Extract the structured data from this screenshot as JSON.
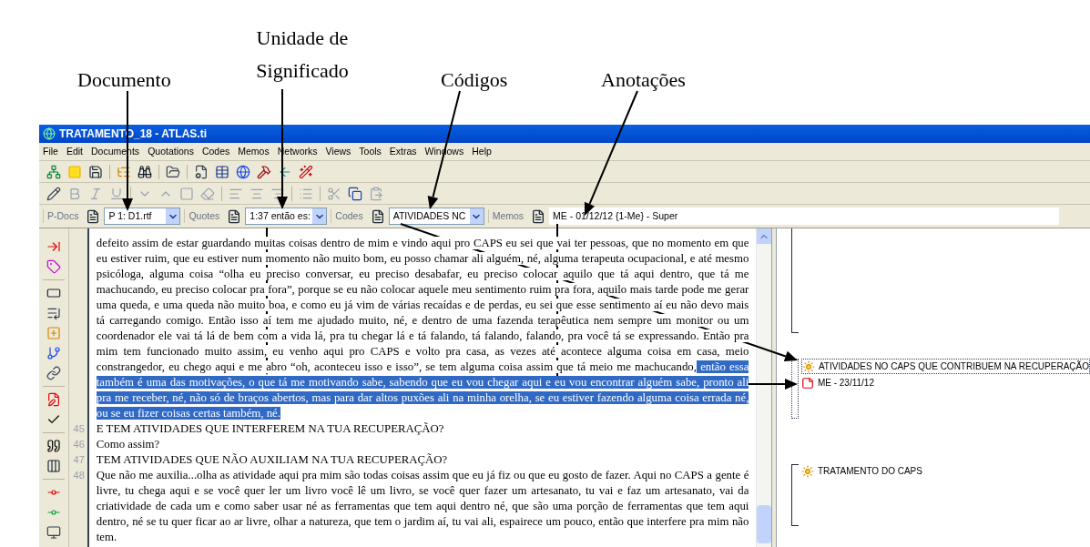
{
  "callouts": [
    {
      "text": "Documento"
    },
    {
      "text": "Unidade de Significado"
    },
    {
      "text": "Códigos"
    },
    {
      "text": "Anotações"
    }
  ],
  "window": {
    "title": "TRATAMENTO_18 - ATLAS.ti"
  },
  "menu": [
    "File",
    "Edit",
    "Documents",
    "Quotations",
    "Codes",
    "Memos",
    "Networks",
    "Views",
    "Tools",
    "Extras",
    "Windows",
    "Help"
  ],
  "selectors": [
    {
      "label": "P-Docs",
      "value": "P 1: D1.rtf",
      "kind": "combo"
    },
    {
      "label": "Quotes",
      "value": "1:37 então es:",
      "kind": "combo"
    },
    {
      "label": "Codes",
      "value": "ATIVIDADES NC",
      "kind": "combo"
    },
    {
      "label": "Memos",
      "value": "ME - 01/12/12 {1-Me} - Super",
      "kind": "field"
    }
  ],
  "document": {
    "blocks": [
      {
        "lines": [
          [
            {
              "text": "defeito assim de estar guardando muitas coisas dentro de mim e vindo aqui pro CAPS  eu sei que vai ter pessoas, que no momento em que",
              "selected": false
            }
          ],
          [
            {
              "text": "eu estiver ruim, que eu estiver num momento não muito bom, eu posso chamar ali alguém, né, alguma terapeuta ocupacional, e até mesmo",
              "selected": false
            }
          ],
          [
            {
              "text": "psicóloga, alguma coisa “olha eu preciso conversar, eu preciso desabafar, eu preciso colocar aquilo que tá aqui dentro, que tá me",
              "selected": false
            }
          ],
          [
            {
              "text": "machucando, eu preciso colocar pra fora”, porque se eu não colocar aquele meu sentimento ruim pra fora, aquilo mais tarde pode me gerar",
              "selected": false
            }
          ],
          [
            {
              "text": "uma queda, e uma queda não muito boa, e como eu já vim de várias recaídas e de perdas, eu sei que esse sentimento aí eu não devo mais",
              "selected": false
            }
          ],
          [
            {
              "text": "tá carregando comigo. Então isso aí tem me ajudado muito, né, e dentro de uma fazenda terapêutica nem sempre um monitor ou um",
              "selected": false
            }
          ],
          [
            {
              "text": "coordenador ele vai tá lá de bem com a vida lá, pra tu chegar lá e tá falando, tá falando, falando, pra você tá se expressando. Então pra",
              "selected": false
            }
          ],
          [
            {
              "text": "mim tem funcionado muito assim, eu venho aqui pro CAPS e volto pra casa, as vezes até acontece alguma coisa em casa, meio",
              "selected": false
            }
          ],
          [
            {
              "text": "constrangedor, eu chego aqui e me abro “oh, aconteceu isso e isso”, se tem alguma coisa assim que tá meio me machucando,",
              "selected": false
            },
            {
              "text": "então essa",
              "selected": true
            }
          ],
          [
            {
              "text": "também é uma das motivações, o que tá me motivando sabe, sabendo que eu vou chegar aqui e eu vou encontrar alguém sabe, pronto ali",
              "selected": true
            }
          ],
          [
            {
              "text": "pra me receber, né, não só de braços abertos, mas para dar altos puxões ali na minha orelha, se eu estiver fazendo alguma coisa errada né,",
              "selected": true
            }
          ],
          [
            {
              "text": "ou se eu fizer coisas certas também, né.",
              "selected": true
            }
          ]
        ]
      },
      {
        "number": "45",
        "lines": [
          [
            {
              "text": "E TEM ATIVIDADES QUE INTERFEREM NA TUA RECUPERAÇÃO?",
              "selected": false
            }
          ]
        ]
      },
      {
        "number": "46",
        "lines": [
          [
            {
              "text": "Como assim?",
              "selected": false
            }
          ]
        ]
      },
      {
        "number": "47",
        "lines": [
          [
            {
              "text": "TEM ATIVIDADES QUE NÃO AUXILIAM NA TUA RECUPERAÇÃO?",
              "selected": false
            }
          ]
        ]
      },
      {
        "number": "48",
        "lines": [
          [
            {
              "text": "Que não me auxilia...olha as atividade aqui pra mim são todas coisas assim que eu já fiz ou que eu gosto de fazer. Aqui no CAPS a gente é",
              "selected": false
            }
          ],
          [
            {
              "text": "livre, tu chega aqui e se você quer ler um livro você lê um livro, se você quer fazer um artesanato, tu vai e faz um artesanato, vai da",
              "selected": false
            }
          ],
          [
            {
              "text": "criatividade de cada um e como saber usar né as ferramentas que tem aqui dentro né, que são uma porção de ferramentas que tem aqui",
              "selected": false
            }
          ],
          [
            {
              "text": "dentro, né se tu quer ficar ao ar livre, olhar a natureza, que tem o jardim aí, tu vai ali, espairece um pouco, então que interfere pra mim não",
              "selected": false
            }
          ],
          [
            {
              "text": "tem.",
              "selected": false
            }
          ]
        ]
      }
    ]
  },
  "margin": {
    "groups": [
      {
        "selected": false
      },
      {
        "selected": true,
        "items": [
          {
            "kind": "code",
            "label": "ATIVIDADES NO CAPS QUE CONTRIBUEM NA RECUPERAÇÃO"
          },
          {
            "kind": "memo",
            "label": "ME - 23/11/12"
          }
        ]
      },
      {
        "selected": false,
        "items": [
          {
            "kind": "code",
            "label": "TRATAMENTO DO CAPS"
          }
        ]
      }
    ]
  }
}
